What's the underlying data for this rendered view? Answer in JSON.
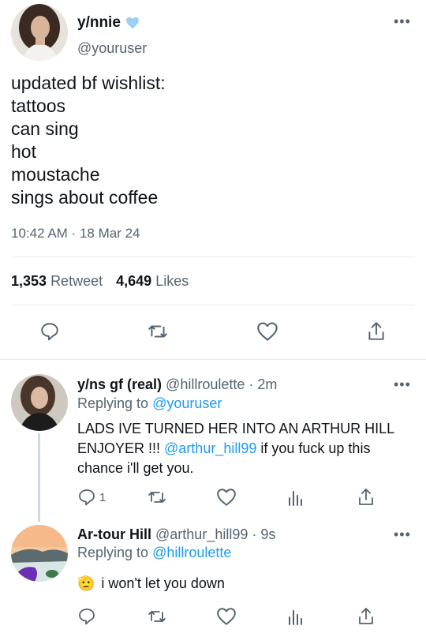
{
  "main_tweet": {
    "display_name": "y/nnie",
    "handle": "@youruser",
    "text_lines": [
      "updated bf wishlist:",
      "tattoos",
      "can sing",
      "hot",
      "moustache",
      "sings about coffee"
    ],
    "time": "10:42 AM",
    "separator": "·",
    "date": "18 Mar 24",
    "retweets_count": "1,353",
    "retweets_label": "Retweet",
    "likes_count": "4,649",
    "likes_label": "Likes"
  },
  "reply1": {
    "display_name": "y/ns gf (real)",
    "handle": "@hillroulette",
    "time": "· 2m",
    "replying_prefix": "Replying to",
    "replying_to": "@youruser",
    "text_before": "LADS IVE TURNED HER INTO AN ARTHUR HILL ENJOYER !!! ",
    "mention": "@arthur_hill99",
    "text_after": " if you fuck up this chance i'll get you.",
    "reply_count": "1"
  },
  "reply2": {
    "display_name": "Ar-tour Hill",
    "handle": "@arthur_hill99",
    "time": "· 9s",
    "replying_prefix": "Replying to",
    "replying_to": "@hillroulette",
    "emoji": "🫡",
    "text": "i won't let you down"
  },
  "colors": {
    "accent": "#1d9bf0",
    "muted": "#536471",
    "text": "#0f1419",
    "divider": "#e6ecf0",
    "verified_heart": "#9ad0f5"
  }
}
